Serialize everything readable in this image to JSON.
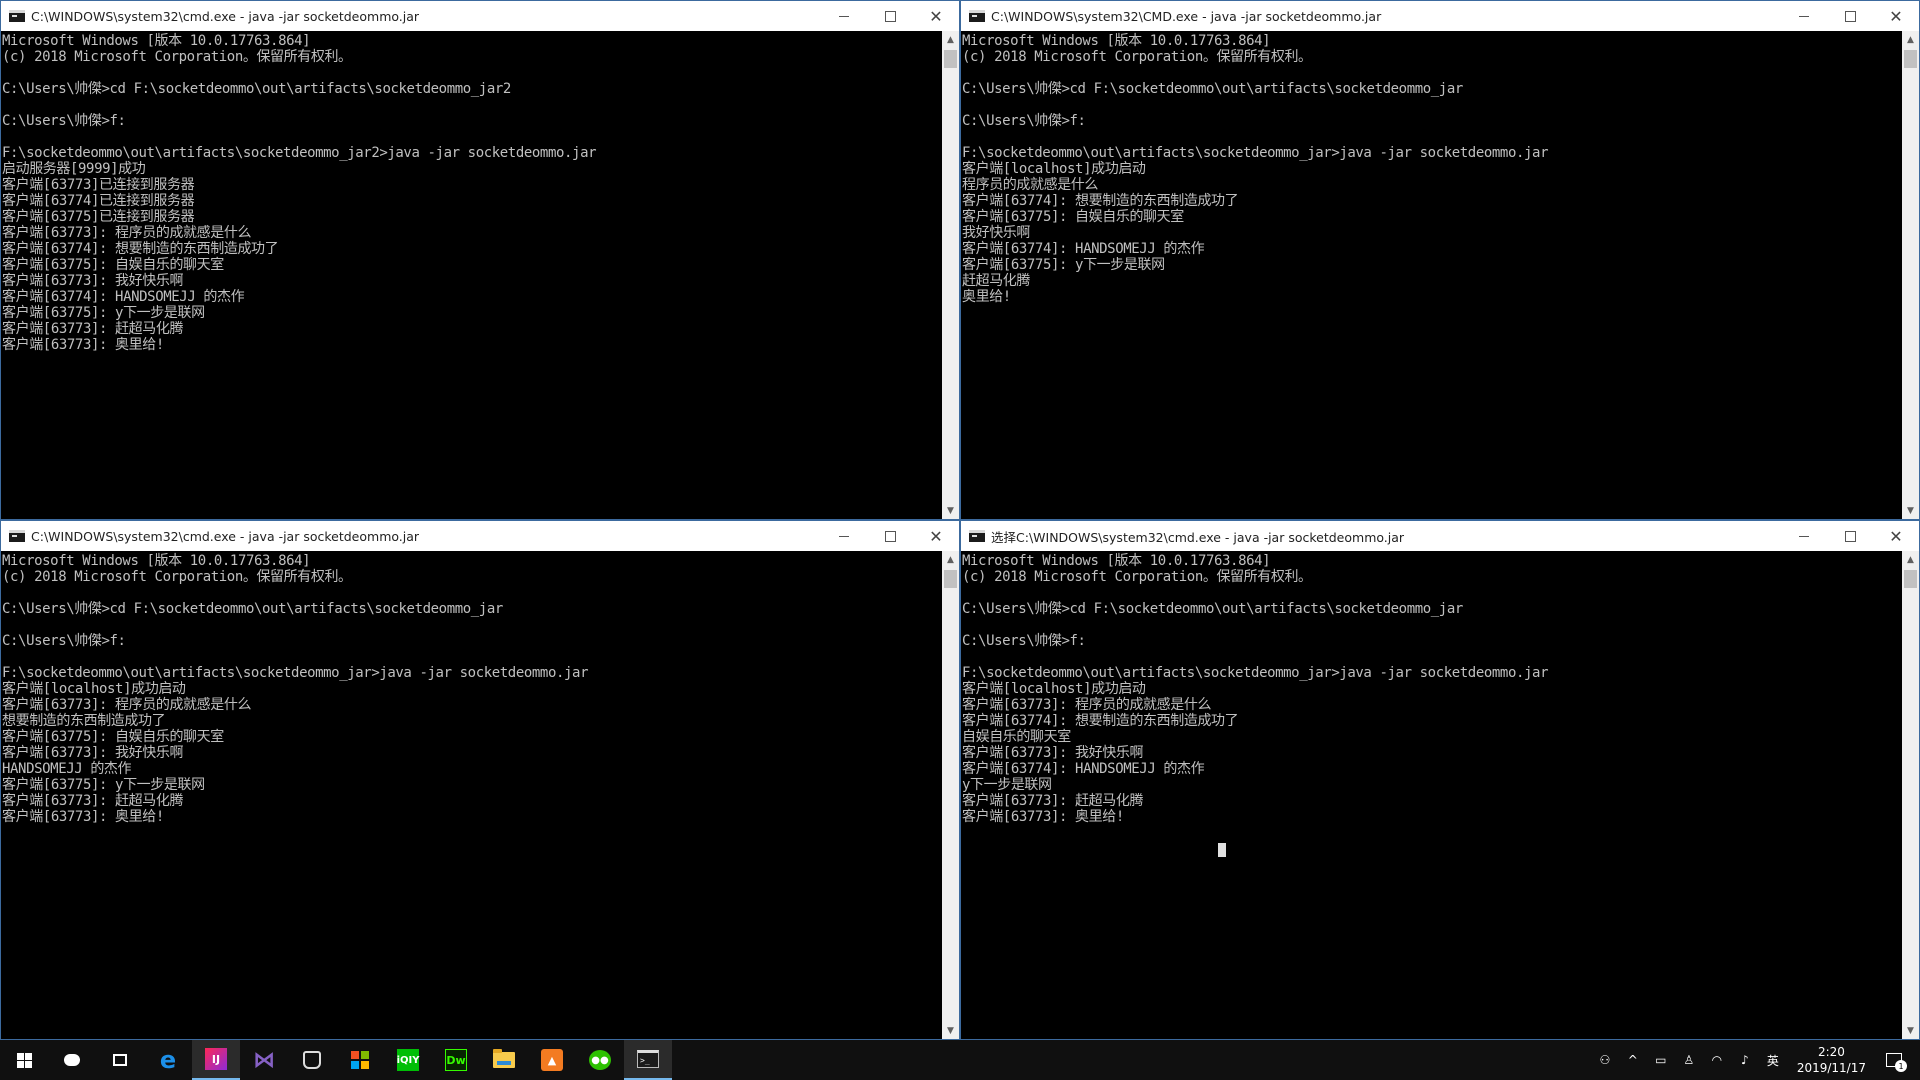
{
  "windows": [
    {
      "id": "win-tl",
      "title": "C:\\WINDOWS\\system32\\cmd.exe - java  -jar socketdeommo.jar",
      "lines": [
        "Microsoft Windows [版本 10.0.17763.864]",
        "(c) 2018 Microsoft Corporation。保留所有权利。",
        "",
        "C:\\Users\\帅傑>cd F:\\socketdeommo\\out\\artifacts\\socketdeommo_jar2",
        "",
        "C:\\Users\\帅傑>f:",
        "",
        "F:\\socketdeommo\\out\\artifacts\\socketdeommo_jar2>java -jar socketdeommo.jar",
        "启动服务器[9999]成功",
        "客户端[63773]已连接到服务器",
        "客户端[63774]已连接到服务器",
        "客户端[63775]已连接到服务器",
        "客户端[63773]: 程序员的成就感是什么",
        "客户端[63774]: 想要制造的东西制造成功了",
        "客户端[63775]: 自娱自乐的聊天室",
        "客户端[63773]: 我好快乐啊",
        "客户端[63774]: HANDSOMEJJ 的杰作",
        "客户端[63775]: y下一步是联网",
        "客户端[63773]: 赶超马化腾",
        "客户端[63773]: 奥里给!"
      ]
    },
    {
      "id": "win-tr",
      "title": "C:\\WINDOWS\\system32\\CMD.exe - java  -jar socketdeommo.jar",
      "lines": [
        "Microsoft Windows [版本 10.0.17763.864]",
        "(c) 2018 Microsoft Corporation。保留所有权利。",
        "",
        "C:\\Users\\帅傑>cd F:\\socketdeommo\\out\\artifacts\\socketdeommo_jar",
        "",
        "C:\\Users\\帅傑>f:",
        "",
        "F:\\socketdeommo\\out\\artifacts\\socketdeommo_jar>java -jar socketdeommo.jar",
        "客户端[localhost]成功启动",
        "程序员的成就感是什么",
        "客户端[63774]: 想要制造的东西制造成功了",
        "客户端[63775]: 自娱自乐的聊天室",
        "我好快乐啊",
        "客户端[63774]: HANDSOMEJJ 的杰作",
        "客户端[63775]: y下一步是联网",
        "赶超马化腾",
        "奥里给!"
      ]
    },
    {
      "id": "win-bl",
      "title": "C:\\WINDOWS\\system32\\cmd.exe - java  -jar socketdeommo.jar",
      "lines": [
        "Microsoft Windows [版本 10.0.17763.864]",
        "(c) 2018 Microsoft Corporation。保留所有权利。",
        "",
        "C:\\Users\\帅傑>cd F:\\socketdeommo\\out\\artifacts\\socketdeommo_jar",
        "",
        "C:\\Users\\帅傑>f:",
        "",
        "F:\\socketdeommo\\out\\artifacts\\socketdeommo_jar>java -jar socketdeommo.jar",
        "客户端[localhost]成功启动",
        "客户端[63773]: 程序员的成就感是什么",
        "想要制造的东西制造成功了",
        "客户端[63775]: 自娱自乐的聊天室",
        "客户端[63773]: 我好快乐啊",
        "HANDSOMEJJ 的杰作",
        "客户端[63775]: y下一步是联网",
        "客户端[63773]: 赶超马化腾",
        "客户端[63773]: 奥里给!"
      ]
    },
    {
      "id": "win-br",
      "title": "选择C:\\WINDOWS\\system32\\cmd.exe - java  -jar socketdeommo.jar",
      "lines": [
        "Microsoft Windows [版本 10.0.17763.864]",
        "(c) 2018 Microsoft Corporation。保留所有权利。",
        "",
        "C:\\Users\\帅傑>cd F:\\socketdeommo\\out\\artifacts\\socketdeommo_jar",
        "",
        "C:\\Users\\帅傑>f:",
        "",
        "F:\\socketdeommo\\out\\artifacts\\socketdeommo_jar>java -jar socketdeommo.jar",
        "客户端[localhost]成功启动",
        "客户端[63773]: 程序员的成就感是什么",
        "客户端[63774]: 想要制造的东西制造成功了",
        "自娱自乐的聊天室",
        "客户端[63773]: 我好快乐啊",
        "客户端[63774]: HANDSOMEJJ 的杰作",
        "y下一步是联网",
        "客户端[63773]: 赶超马化腾",
        "客户端[63773]: 奥里给!"
      ]
    }
  ],
  "window_controls": {
    "close_glyph": "✕"
  },
  "taskbar": {
    "iqiyi_label": "iQIY",
    "dw_label": "Dw",
    "idea_label": "IJ",
    "cmd_label": ">_",
    "tray": {
      "ime_label": "英",
      "time": "2:20",
      "date": "2019/11/17",
      "notification_count": "1"
    }
  },
  "colors": {
    "console_text": "#c0c0c0",
    "console_bg": "#000000",
    "taskbar_bg": "#101010",
    "active_indicator": "#76b9ed"
  }
}
